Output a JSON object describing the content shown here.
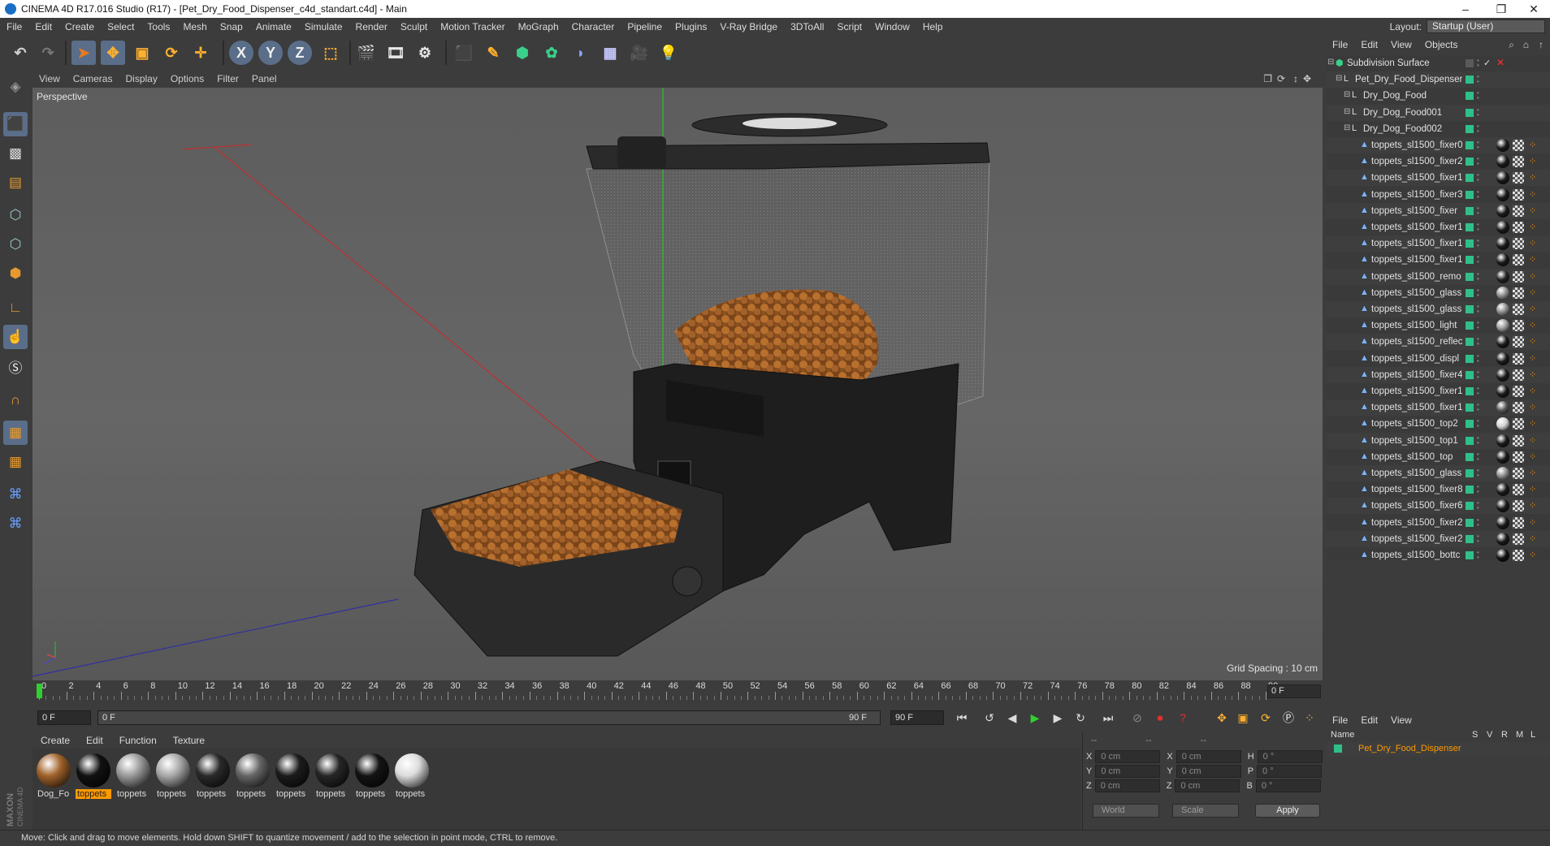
{
  "window": {
    "title": "CINEMA 4D R17.016 Studio (R17) - [Pet_Dry_Food_Dispenser_c4d_standart.c4d] - Main",
    "minimize_glyph": "–",
    "restore_glyph": "❐",
    "close_glyph": "✕"
  },
  "menubar": {
    "items": [
      "File",
      "Edit",
      "Create",
      "Select",
      "Tools",
      "Mesh",
      "Snap",
      "Animate",
      "Simulate",
      "Render",
      "Sculpt",
      "Motion Tracker",
      "MoGraph",
      "Character",
      "Pipeline",
      "Plugins",
      "V-Ray Bridge",
      "3DToAll",
      "Script",
      "Window",
      "Help"
    ],
    "layout_label": "Layout:",
    "layout_value": "Startup (User)"
  },
  "toolbar": {
    "axis_x": "X",
    "axis_y": "Y",
    "axis_z": "Z"
  },
  "viewport": {
    "menu": [
      "View",
      "Cameras",
      "Display",
      "Options",
      "Filter",
      "Panel"
    ],
    "label": "Perspective",
    "grid_spacing": "Grid Spacing : 10 cm"
  },
  "timeline": {
    "ticks": [
      "0",
      "2",
      "4",
      "6",
      "8",
      "10",
      "12",
      "14",
      "16",
      "18",
      "20",
      "22",
      "24",
      "26",
      "28",
      "30",
      "32",
      "34",
      "36",
      "38",
      "40",
      "42",
      "44",
      "46",
      "48",
      "50",
      "52",
      "54",
      "56",
      "58",
      "60",
      "62",
      "64",
      "66",
      "68",
      "70",
      "72",
      "74",
      "76",
      "78",
      "80",
      "82",
      "84",
      "86",
      "88",
      "90"
    ],
    "current_frame": "0 F",
    "start_field": "0 F",
    "range_start": "0 F",
    "range_end": "90 F",
    "end_field": "90 F"
  },
  "materials": {
    "menu": [
      "Create",
      "Edit",
      "Function",
      "Texture"
    ],
    "items": [
      {
        "label": "Dog_Fo",
        "color": "#a0622a",
        "selected": false
      },
      {
        "label": "toppets",
        "color": "#111111",
        "selected": true
      },
      {
        "label": "toppets",
        "color": "#9a9a9a",
        "selected": false
      },
      {
        "label": "toppets",
        "color": "#a8a8a8",
        "selected": false
      },
      {
        "label": "toppets",
        "color": "#2a2a2a",
        "selected": false
      },
      {
        "label": "toppets",
        "color": "#666666",
        "selected": false
      },
      {
        "label": "toppets",
        "color": "#1c1c1c",
        "selected": false
      },
      {
        "label": "toppets",
        "color": "#262626",
        "selected": false
      },
      {
        "label": "toppets",
        "color": "#141414",
        "selected": false
      },
      {
        "label": "toppets",
        "color": "#dcdcdc",
        "selected": false
      }
    ]
  },
  "coords": {
    "header": [
      "--",
      "--",
      "--"
    ],
    "rows": [
      {
        "a": "X",
        "av": "0 cm",
        "b": "X",
        "bv": "0 cm",
        "c": "H",
        "cv": "0 °"
      },
      {
        "a": "Y",
        "av": "0 cm",
        "b": "Y",
        "bv": "0 cm",
        "c": "P",
        "cv": "0 °"
      },
      {
        "a": "Z",
        "av": "0 cm",
        "b": "Z",
        "bv": "0 cm",
        "c": "B",
        "cv": "0 °"
      }
    ],
    "world": "World",
    "scale": "Scale",
    "apply": "Apply"
  },
  "objects": {
    "menu": [
      "File",
      "Edit",
      "View",
      "Objects"
    ],
    "items": [
      {
        "name": "Subdivision Surface",
        "level": 0,
        "kind": "sub"
      },
      {
        "name": "Pet_Dry_Food_Dispenser",
        "level": 1,
        "kind": "null"
      },
      {
        "name": "Dry_Dog_Food",
        "level": 2,
        "kind": "null"
      },
      {
        "name": "Dry_Dog_Food001",
        "level": 2,
        "kind": "null"
      },
      {
        "name": "Dry_Dog_Food002",
        "level": 2,
        "kind": "null"
      },
      {
        "name": "toppets_sl1500_fixer0",
        "level": 3,
        "kind": "mesh",
        "mat": "#1a1a1a"
      },
      {
        "name": "toppets_sl1500_fixer2",
        "level": 3,
        "kind": "mesh",
        "mat": "#1a1a1a"
      },
      {
        "name": "toppets_sl1500_fixer1",
        "level": 3,
        "kind": "mesh",
        "mat": "#1a1a1a"
      },
      {
        "name": "toppets_sl1500_fixer3",
        "level": 3,
        "kind": "mesh",
        "mat": "#1a1a1a"
      },
      {
        "name": "toppets_sl1500_fixer",
        "level": 3,
        "kind": "mesh",
        "mat": "#1a1a1a"
      },
      {
        "name": "toppets_sl1500_fixer1",
        "level": 3,
        "kind": "mesh",
        "mat": "#1a1a1a"
      },
      {
        "name": "toppets_sl1500_fixer1",
        "level": 3,
        "kind": "mesh",
        "mat": "#1a1a1a"
      },
      {
        "name": "toppets_sl1500_fixer1",
        "level": 3,
        "kind": "mesh",
        "mat": "#1a1a1a"
      },
      {
        "name": "toppets_sl1500_remo",
        "level": 3,
        "kind": "mesh",
        "mat": "#222222"
      },
      {
        "name": "toppets_sl1500_glass",
        "level": 3,
        "kind": "mesh",
        "mat": "#8a8a8a"
      },
      {
        "name": "toppets_sl1500_glass",
        "level": 3,
        "kind": "mesh",
        "mat": "#8a8a8a"
      },
      {
        "name": "toppets_sl1500_light",
        "level": 3,
        "kind": "mesh",
        "mat": "#9a9a9a"
      },
      {
        "name": "toppets_sl1500_reflec",
        "level": 3,
        "kind": "mesh",
        "mat": "#1a1a1a"
      },
      {
        "name": "toppets_sl1500_displ",
        "level": 3,
        "kind": "mesh",
        "mat": "#1a1a1a"
      },
      {
        "name": "toppets_sl1500_fixer4",
        "level": 3,
        "kind": "mesh",
        "mat": "#1a1a1a"
      },
      {
        "name": "toppets_sl1500_fixer1",
        "level": 3,
        "kind": "mesh",
        "mat": "#1a1a1a"
      },
      {
        "name": "toppets_sl1500_fixer1",
        "level": 3,
        "kind": "mesh",
        "mat": "#555555"
      },
      {
        "name": "toppets_sl1500_top2",
        "level": 3,
        "kind": "mesh",
        "mat": "#d0d0d0"
      },
      {
        "name": "toppets_sl1500_top1",
        "level": 3,
        "kind": "mesh",
        "mat": "#1a1a1a"
      },
      {
        "name": "toppets_sl1500_top",
        "level": 3,
        "kind": "mesh",
        "mat": "#1a1a1a"
      },
      {
        "name": "toppets_sl1500_glass",
        "level": 3,
        "kind": "mesh",
        "mat": "#8a8a8a"
      },
      {
        "name": "toppets_sl1500_fixer8",
        "level": 3,
        "kind": "mesh",
        "mat": "#1a1a1a"
      },
      {
        "name": "toppets_sl1500_fixer6",
        "level": 3,
        "kind": "mesh",
        "mat": "#1a1a1a"
      },
      {
        "name": "toppets_sl1500_fixer2",
        "level": 3,
        "kind": "mesh",
        "mat": "#1a1a1a"
      },
      {
        "name": "toppets_sl1500_fixer2",
        "level": 3,
        "kind": "mesh",
        "mat": "#1a1a1a"
      },
      {
        "name": "toppets_sl1500_bottc",
        "level": 3,
        "kind": "mesh",
        "mat": "#111111"
      }
    ]
  },
  "attributes": {
    "menu": [
      "File",
      "Edit",
      "View"
    ],
    "columns": [
      "Name",
      "S",
      "V",
      "R",
      "M",
      "L"
    ],
    "row_name": "Pet_Dry_Food_Dispenser"
  },
  "status": {
    "text": "Move: Click and drag to move elements. Hold down SHIFT to quantize movement / add to the selection in point mode, CTRL to remove."
  },
  "brand": {
    "maxon": "MAXON",
    "cinema": "CINEMA 4D"
  },
  "colors": {
    "accent_orange": "#ff9a00",
    "active_tool": "#5a6e8a",
    "object_green": "#2fc08a"
  }
}
